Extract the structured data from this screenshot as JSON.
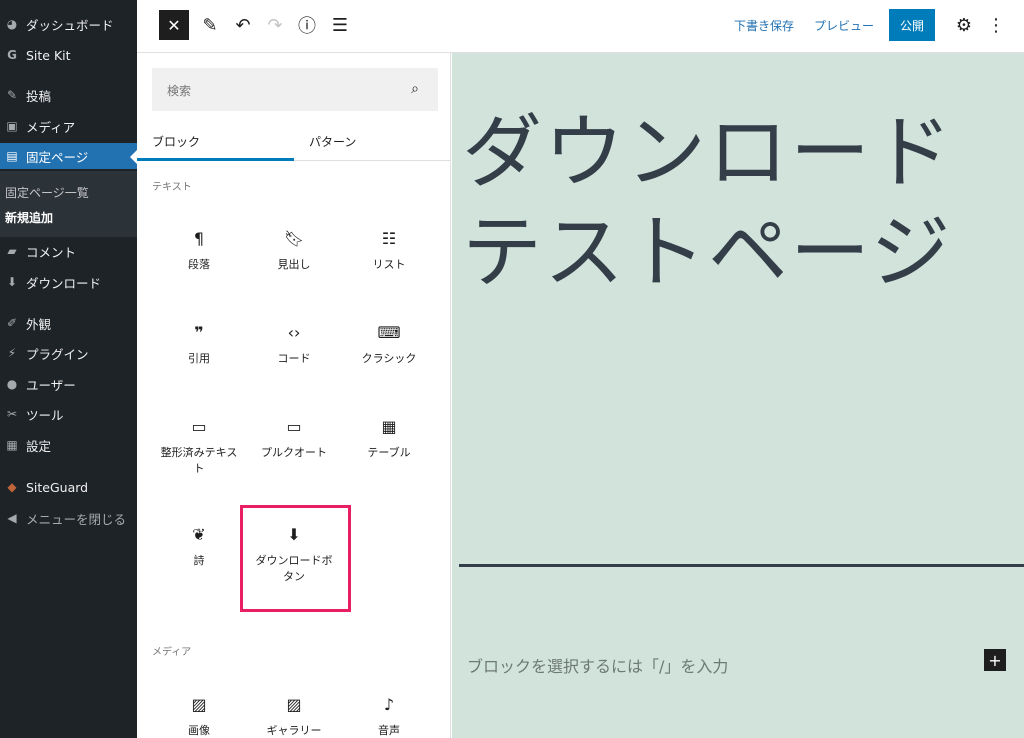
{
  "sidebar": {
    "items": [
      {
        "label": "ダッシュボード",
        "icon": "dashboard-icon"
      },
      {
        "label": "Site Kit",
        "icon": "g-logo-icon"
      },
      {
        "label": "投稿",
        "icon": "pin-icon"
      },
      {
        "label": "メディア",
        "icon": "media-icon"
      },
      {
        "label": "固定ページ",
        "icon": "page-icon"
      },
      {
        "label": "コメント",
        "icon": "comment-icon"
      },
      {
        "label": "ダウンロード",
        "icon": "download-icon"
      },
      {
        "label": "外観",
        "icon": "brush-icon"
      },
      {
        "label": "プラグイン",
        "icon": "plugin-icon"
      },
      {
        "label": "ユーザー",
        "icon": "user-icon"
      },
      {
        "label": "ツール",
        "icon": "wrench-icon"
      },
      {
        "label": "設定",
        "icon": "settings-icon"
      },
      {
        "label": "SiteGuard",
        "icon": "shield-icon"
      },
      {
        "label": "メニューを閉じる",
        "icon": "collapse-icon"
      }
    ],
    "submenu": [
      "固定ページ一覧",
      "新規追加"
    ]
  },
  "toolbar": {
    "save_draft": "下書き保存",
    "preview": "プレビュー",
    "publish": "公開"
  },
  "inserter": {
    "search_placeholder": "検索",
    "tabs": [
      "ブロック",
      "パターン"
    ],
    "categories": [
      "テキスト",
      "メディア"
    ],
    "blocks": [
      {
        "label": "段落",
        "icon": "paragraph-icon"
      },
      {
        "label": "見出し",
        "icon": "heading-icon"
      },
      {
        "label": "リスト",
        "icon": "list-icon"
      },
      {
        "label": "引用",
        "icon": "quote-icon"
      },
      {
        "label": "コード",
        "icon": "code-icon"
      },
      {
        "label": "クラシック",
        "icon": "keyboard-icon"
      },
      {
        "label": "整形済みテキスト",
        "icon": "preformatted-icon"
      },
      {
        "label": "プルクオート",
        "icon": "pullquote-icon"
      },
      {
        "label": "テーブル",
        "icon": "table-icon"
      },
      {
        "label": "詩",
        "icon": "feather-icon"
      },
      {
        "label": "ダウンロードボタン",
        "icon": "download-icon"
      },
      {
        "label": "画像",
        "icon": "image-icon"
      },
      {
        "label": "ギャラリー",
        "icon": "gallery-icon"
      },
      {
        "label": "音声",
        "icon": "audio-icon"
      }
    ]
  },
  "editor": {
    "title": "ダウンロードテストページ",
    "placeholder": "ブロックを選択するには「/」を入力"
  }
}
